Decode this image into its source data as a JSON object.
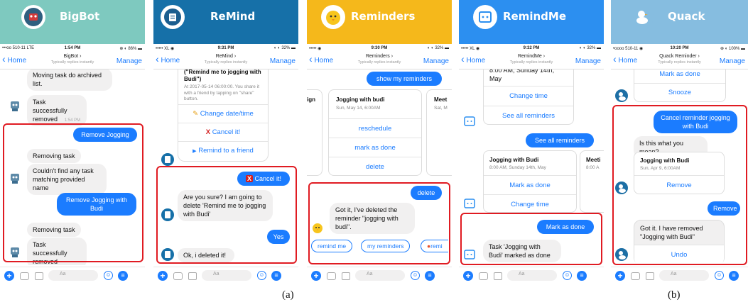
{
  "captions": {
    "a": "(a)",
    "b": "(b)"
  },
  "panels": [
    {
      "app_name": "BigBot",
      "header_color": "#7ec9bf",
      "status": {
        "left": "•••oo 510-11  LTE",
        "time": "1:54 PM",
        "right": "⊕ ◐ 86% ▬"
      },
      "nav": {
        "back": "Home",
        "title": "BigBot ›",
        "subtitle": "Typically replies instantly",
        "manage": "Manage"
      },
      "messages": {
        "m1": "Moving task do archived list.",
        "m2": "Task successfully removed",
        "time": "1:54 PM",
        "u1": "Remove Jogging",
        "m3": "Removing task",
        "m4": "Couldn't find any task matching provided name",
        "u2": "Remove Jogging with Budi",
        "m5": "Removing task",
        "m6": "Task successfully removed"
      }
    },
    {
      "app_name": "ReMind",
      "header_color": "#1670a8",
      "status": {
        "left": "•••••  XL  ◉",
        "time": "9:31 PM",
        "right": "◐ ◐ 32% ▬"
      },
      "nav": {
        "back": "Home",
        "title": "ReMind ›",
        "subtitle": "Typically replies instantly",
        "manage": "Manage"
      },
      "messages": {
        "card_title": "(\"Remind me to jogging with Budi\")",
        "card_body": "At 2017-05-14 06:00:00. You share it with a friend by tapping on \"share\" button.",
        "btn1": "Change date/time",
        "btn2": "Cancel it!",
        "btn3": "Remind to a friend",
        "u1": "Cancel it!",
        "m1": "Are you sure? I am going to delete 'Remind me to jogging with Budi'",
        "u2": "Yes",
        "m2": "Ok, i deleted it!"
      }
    },
    {
      "app_name": "Reminders",
      "header_color": "#f5b81b",
      "status": {
        "left": "•••••  ◉",
        "time": "9:30 PM",
        "right": "◐ ◐ 32% ▬"
      },
      "nav": {
        "back": "Home",
        "title": "Reminders ›",
        "subtitle": "Typically replies instantly",
        "manage": "Manage"
      },
      "messages": {
        "u1": "show my reminders",
        "frag_left": "ign",
        "card_title": "Jogging with budi",
        "card_sub": "Sun, May 14, 6:00AM",
        "frag_right_title": "Meet",
        "frag_right_sub": "Sat, M",
        "btn1": "reschedule",
        "btn2": "mark as done",
        "btn3": "delete",
        "u2": "delete",
        "m1": "Got it, I've deleted the reminder \"jogging with budi\".",
        "qr1": "remind me",
        "qr2": "my reminders",
        "qr3": "remi"
      }
    },
    {
      "app_name": "RemindMe",
      "header_color": "#2c8ff0",
      "status": {
        "left": "•••••  XL  ◉",
        "time": "9:32 PM",
        "right": "◐ ◐ 32% ▬"
      },
      "nav": {
        "back": "Home",
        "title": "RemindMe ›",
        "subtitle": "Typically replies instantly",
        "manage": "Manage"
      },
      "messages": {
        "card_top": "8:00 AM, Sunday 14th, May",
        "btn1": "Change time",
        "btn2": "See all reminders",
        "u1": "See all reminders",
        "card_title": "Jogging with Budi",
        "card_sub": "8:00 AM, Sunday 14th, May",
        "frag_title": "Meeti",
        "frag_sub": "8:00 A",
        "btn3": "Mark as done",
        "btn4": "Change time",
        "u2": "Mark as done",
        "m1": "Task 'Jogging with Budi' marked as done"
      }
    },
    {
      "app_name": "Quack",
      "header_color": "#86bde0",
      "status": {
        "left": "•oooo 510-11  ◉",
        "time": "10:20 PM",
        "right": "⊕ ◐ 100% ▬"
      },
      "nav": {
        "back": "Home",
        "title": "Quack Reminder ›",
        "subtitle": "Typically replies instantly",
        "manage": "Manage"
      },
      "messages": {
        "btn1": "Mark as done",
        "btn2": "Snooze",
        "u1": "Cancel reminder jogging with Budi",
        "m1": "Is this what you mean?",
        "card_title": "Jogging with Budi",
        "card_sub": "Sun, Apr 9, 6:00AM",
        "btn3": "Remove",
        "u2": "Remove",
        "m2": "Got it. I have removed \"Jogging with Budi\"",
        "btn4": "Undo"
      }
    }
  ],
  "composer": {
    "placeholder": "Aa"
  },
  "colors": {
    "messenger_blue": "#1b7cff",
    "highlight_red": "#e01b22"
  },
  "icons": [
    "plus-icon",
    "camera-icon",
    "image-icon",
    "emoji-icon",
    "menu-icon",
    "back-chevron-icon",
    "pencil-icon",
    "x-icon",
    "play-icon"
  ]
}
